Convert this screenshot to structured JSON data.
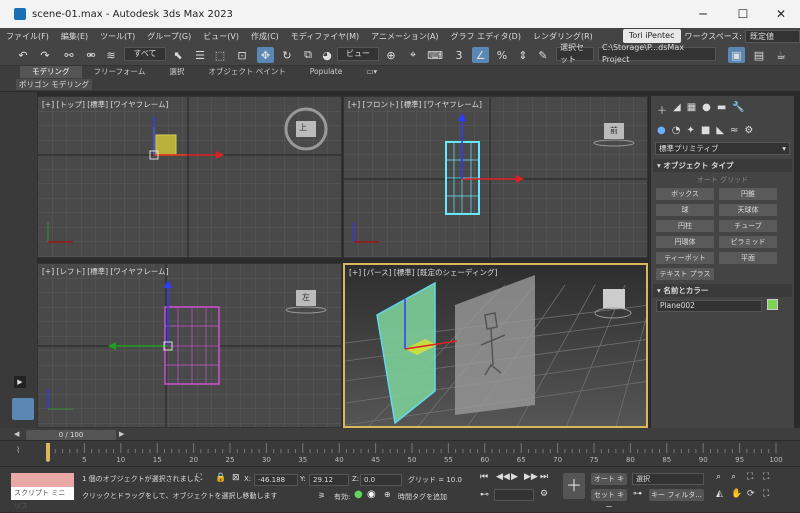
{
  "window": {
    "title": "scene-01.max - Autodesk 3ds Max 2023",
    "minimize": "─",
    "maximize": "☐",
    "close": "✕"
  },
  "menus": [
    "ファイル(F)",
    "編集(E)",
    "ツール(T)",
    "グループ(G)",
    "ビュー(V)",
    "作成(C)",
    "モディファイヤ(M)",
    "アニメーション(A)",
    "グラフ エディタ(D)",
    "レンダリング(R)"
  ],
  "user": "Tori iPentec",
  "workspace": {
    "label": "ワークスペース:",
    "value": "既定値"
  },
  "toolbar": {
    "filter": "すべて",
    "coord": "ビュー",
    "selset": "選択セット",
    "project": "C:\\Storage\\P...dsMax Project"
  },
  "ribbon": {
    "tabs": [
      "モデリング",
      "フリーフォーム",
      "選択",
      "オブジェクト ペイント",
      "Populate"
    ],
    "sub": "ポリゴン モデリング"
  },
  "viewports": {
    "top": "[+] [トップ] [標準] [ワイヤフレーム]",
    "front": "[+] [フロント] [標準] [ワイヤフレーム]",
    "left": "[+] [レフト] [標準] [ワイヤフレーム]",
    "persp": "[+] [パース] [標準] [既定のシェーディング]"
  },
  "viewcube": {
    "top": "上",
    "front": "前",
    "left": "左"
  },
  "command_panel": {
    "category": "標準プリミティブ",
    "rollout_type": "オブジェクト タイプ",
    "autogrid": "オート グリッド",
    "buttons": [
      "ボックス",
      "円錐",
      "球",
      "天球体",
      "円柱",
      "チューブ",
      "円環体",
      "ピラミッド",
      "ティーポット",
      "平面",
      "テキスト プラス"
    ],
    "rollout_name": "名前とカラー",
    "object_name": "Plane002",
    "object_color": "#7ed354"
  },
  "timeline": {
    "slider": "0 / 100",
    "ticks": [
      "0",
      "5",
      "10",
      "15",
      "20",
      "25",
      "30",
      "35",
      "40",
      "45",
      "50",
      "55",
      "60",
      "65",
      "70",
      "75",
      "80",
      "85",
      "90",
      "95",
      "100"
    ]
  },
  "status": {
    "script_label": "スクリプト ミニ リス",
    "selected": "1 個のオブジェクトが選択されました",
    "hint": "クリックとドラッグをして、オブジェクトを選択し移動します",
    "x_label": "X:",
    "x": "-46.188",
    "y_label": "Y:",
    "y": "29.12",
    "z_label": "Z:",
    "z": "0.0",
    "grid": "グリッド = 10.0",
    "enabled": "有効:",
    "add_tag": "時間タグを追加",
    "autokey": "オート キー",
    "setkey": "セット キー",
    "selection": "選択",
    "keyfilter": "キー フィルタ..."
  }
}
